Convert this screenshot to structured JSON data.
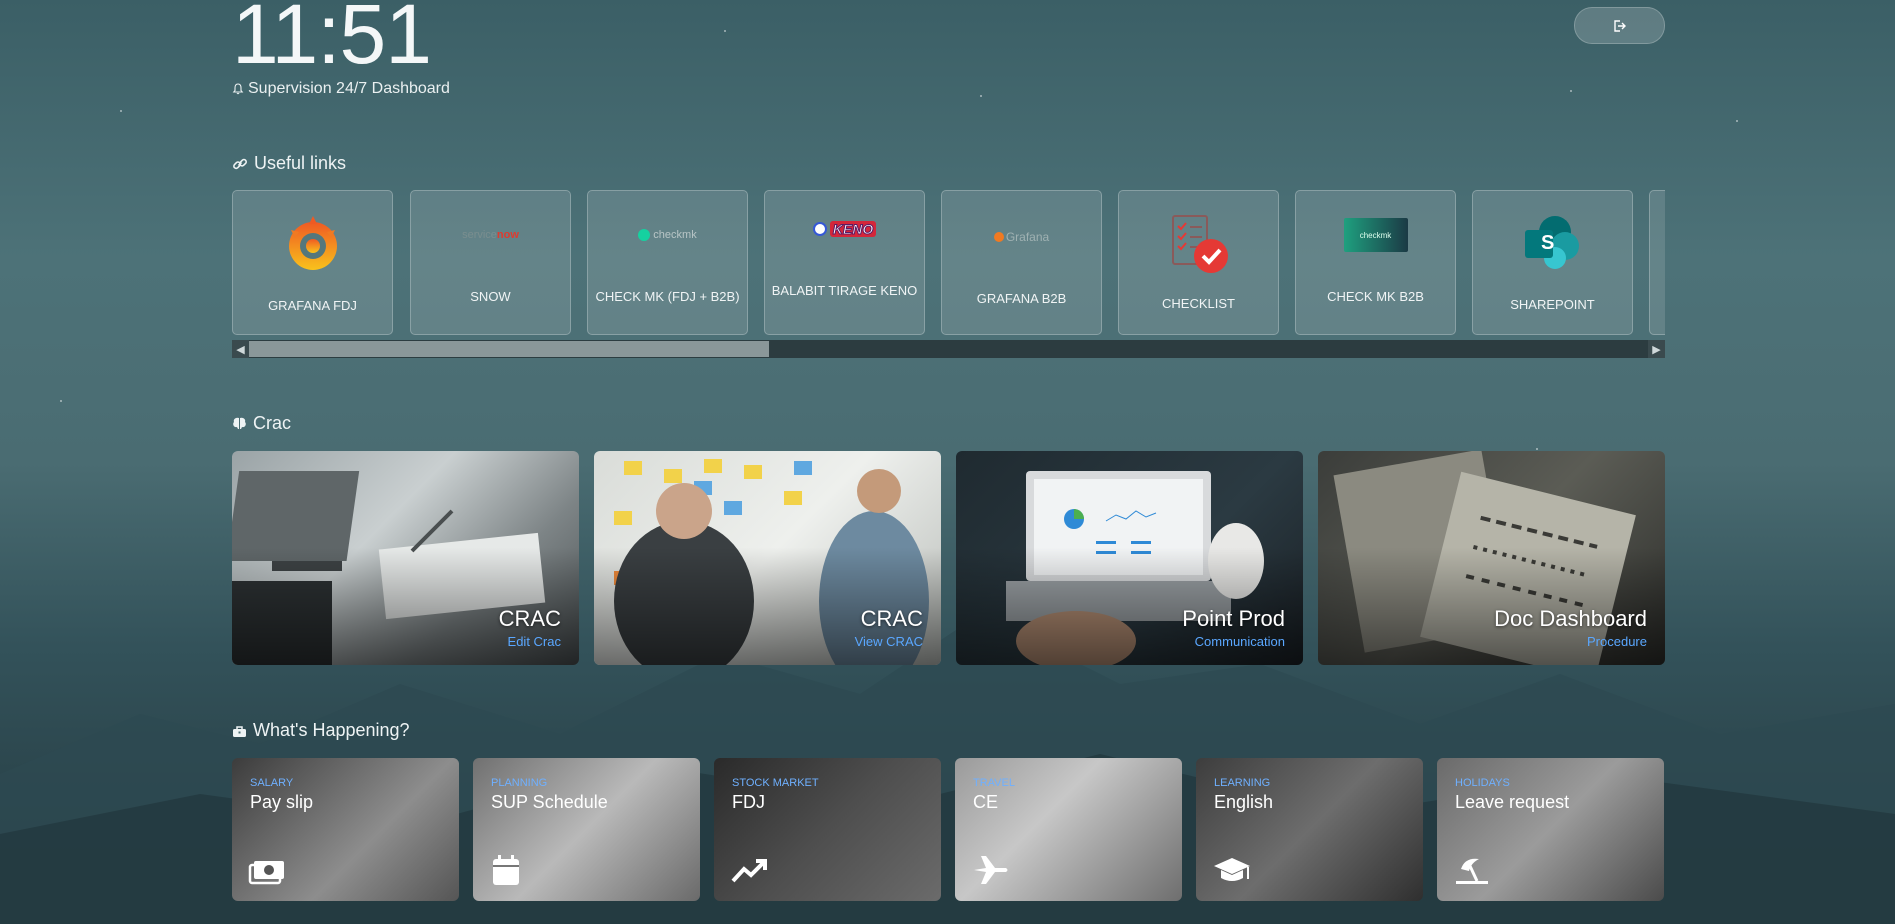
{
  "header": {
    "clock": "11:51",
    "subtitle": "Supervision 24/7 Dashboard"
  },
  "useful_links": {
    "title": "Useful links",
    "items": [
      {
        "label": "GRAFANA FDJ",
        "icon": "grafana-logo"
      },
      {
        "label": "SNOW",
        "icon": "servicenow-logo",
        "logo_text_a": "service",
        "logo_text_b": "now"
      },
      {
        "label": "CHECK MK (FDJ + B2B)",
        "icon": "checkmk-logo",
        "logo_text": "checkmk"
      },
      {
        "label": "BALABIT TIRAGE KENO",
        "icon": "keno-logo",
        "logo_text": "KENO"
      },
      {
        "label": "GRAFANA B2B",
        "icon": "grafana-logo",
        "logo_text": "Grafana"
      },
      {
        "label": "CHECKLIST",
        "icon": "checklist-icon"
      },
      {
        "label": "CHECK MK B2B",
        "icon": "checkmk-logo",
        "logo_text": "checkmk"
      },
      {
        "label": "SHAREPOINT",
        "icon": "sharepoint-logo",
        "logo_text": "S"
      }
    ]
  },
  "crac": {
    "title": "Crac",
    "cards": [
      {
        "title": "CRAC",
        "subtitle": "Edit Crac"
      },
      {
        "title": "CRAC",
        "subtitle": "View CRAC"
      },
      {
        "title": "Point Prod",
        "subtitle": "Communication"
      },
      {
        "title": "Doc Dashboard",
        "subtitle": "Procedure"
      }
    ]
  },
  "happening": {
    "title": "What's Happening?",
    "cards": [
      {
        "category": "SALARY",
        "title": "Pay slip",
        "icon": "money-icon"
      },
      {
        "category": "PLANNING",
        "title": "SUP Schedule",
        "icon": "calendar-icon"
      },
      {
        "category": "STOCK MARKET",
        "title": "FDJ",
        "icon": "trend-up-icon"
      },
      {
        "category": "TRAVEL",
        "title": "CE",
        "icon": "plane-icon"
      },
      {
        "category": "LEARNING",
        "title": "English",
        "icon": "graduation-cap-icon"
      },
      {
        "category": "HOLIDAYS",
        "title": "Leave request",
        "icon": "umbrella-beach-icon"
      }
    ]
  },
  "colors": {
    "accent": "#5aa7ff",
    "background": "#4a6c72"
  }
}
